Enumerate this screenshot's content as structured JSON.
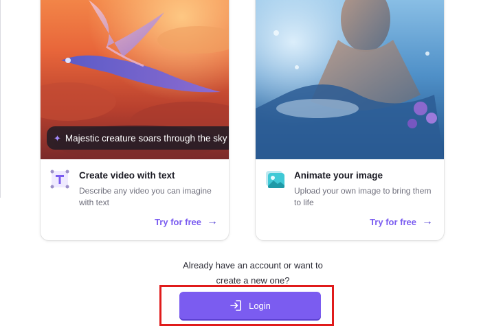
{
  "cards": [
    {
      "image_alt": "Dragon flying through sunset clouds",
      "prompt_chip": "Majestic creature soars through the sky",
      "icon": "text-to-video-icon",
      "title": "Create video with text",
      "description": "Describe any video you can imagine with text",
      "link_label": "Try for free"
    },
    {
      "image_alt": "Man emerging from water",
      "icon": "image-to-video-icon",
      "title": "Animate your image",
      "description": "Upload your own image to bring them to life",
      "link_label": "Try for free"
    }
  ],
  "account_prompt": {
    "line1": "Already have an account or want to",
    "line2": "create a new one?"
  },
  "login_button": {
    "label": "Login",
    "icon": "login-icon"
  },
  "colors": {
    "accent": "#7b5cf0",
    "link": "#7a5cf0",
    "highlight": "#e01b1b"
  }
}
